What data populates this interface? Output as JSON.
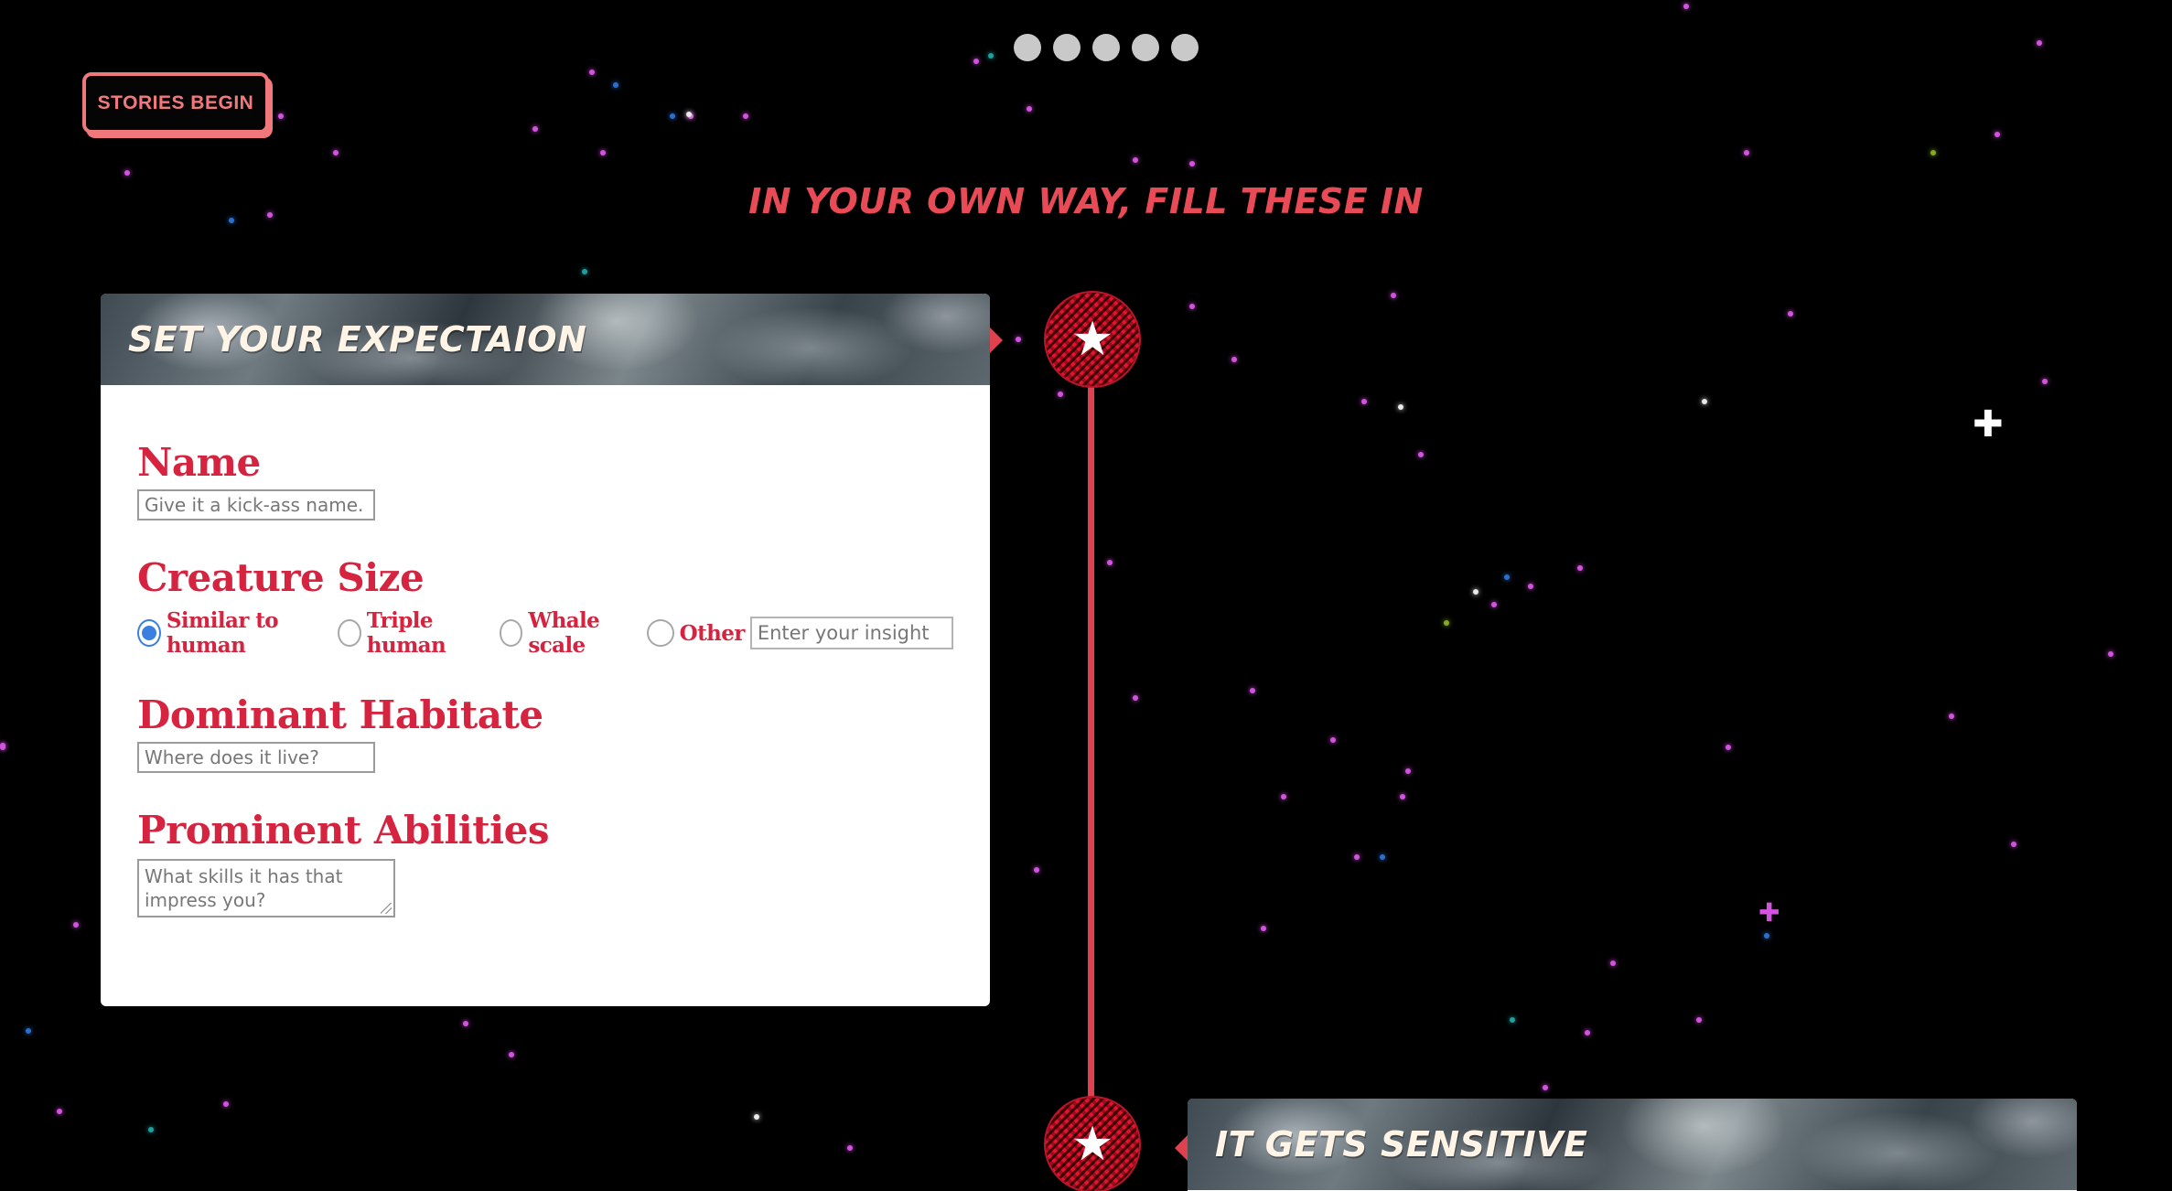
{
  "nav": {
    "stories_label": "STORIES BEGIN",
    "pager_count": 5
  },
  "headline": "IN YOUR OWN WAY, FILL THESE IN",
  "card1": {
    "title": "SET YOUR EXPECTAION",
    "name": {
      "label": "Name",
      "placeholder": "Give it a kick-ass name."
    },
    "size": {
      "label": "Creature Size",
      "options": [
        "Similar to human",
        "Triple human",
        "Whale scale",
        "Other"
      ],
      "selected": "Similar to human",
      "other_placeholder": "Enter your insight"
    },
    "habitat": {
      "label": "Dominant Habitate",
      "placeholder": "Where does it live?"
    },
    "abilities": {
      "label": "Prominent Abilities",
      "placeholder": "What skills it has that impress you?"
    }
  },
  "card2": {
    "title": "IT GETS SENSITIVE"
  },
  "colors": {
    "accent": "#e0414f",
    "label_red": "#d6233f",
    "header_text": "#fff4e6"
  },
  "icons": {
    "timeline_node": "star-icon"
  }
}
